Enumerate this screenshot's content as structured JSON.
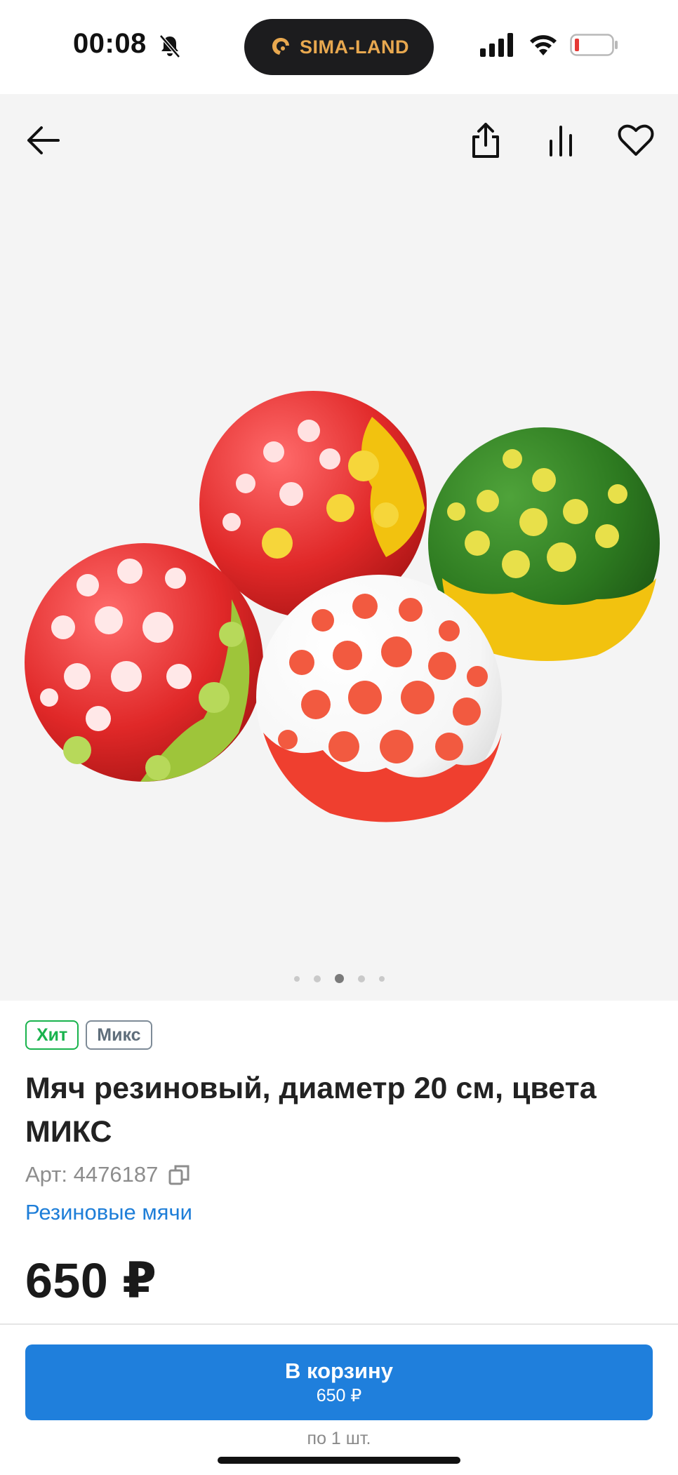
{
  "status": {
    "time": "00:08",
    "island_text": "SIMA-LAND",
    "icons": [
      "bell-muted-icon",
      "signal-icon",
      "wifi-icon",
      "battery-low-icon"
    ],
    "battery_color": "#e53935"
  },
  "gallery": {
    "icons": [
      "back-arrow-icon",
      "share-icon",
      "compare-icon",
      "heart-icon"
    ],
    "image_count": 5,
    "active_index": 3
  },
  "product": {
    "badges": {
      "hit": "Хит",
      "mix": "Микс"
    },
    "title": "Мяч резиновый, диаметр 20 см, цвета МИКС",
    "article": "Арт: 4476187",
    "category": "Резиновые мячи",
    "price": "650 ₽"
  },
  "cart": {
    "button_label": "В корзину",
    "button_price": "650 ₽",
    "per_unit": "по 1 шт."
  },
  "colors": {
    "accent": "#1f7fdc",
    "hit_badge": "#19b34d",
    "link": "#1e7ed8"
  }
}
